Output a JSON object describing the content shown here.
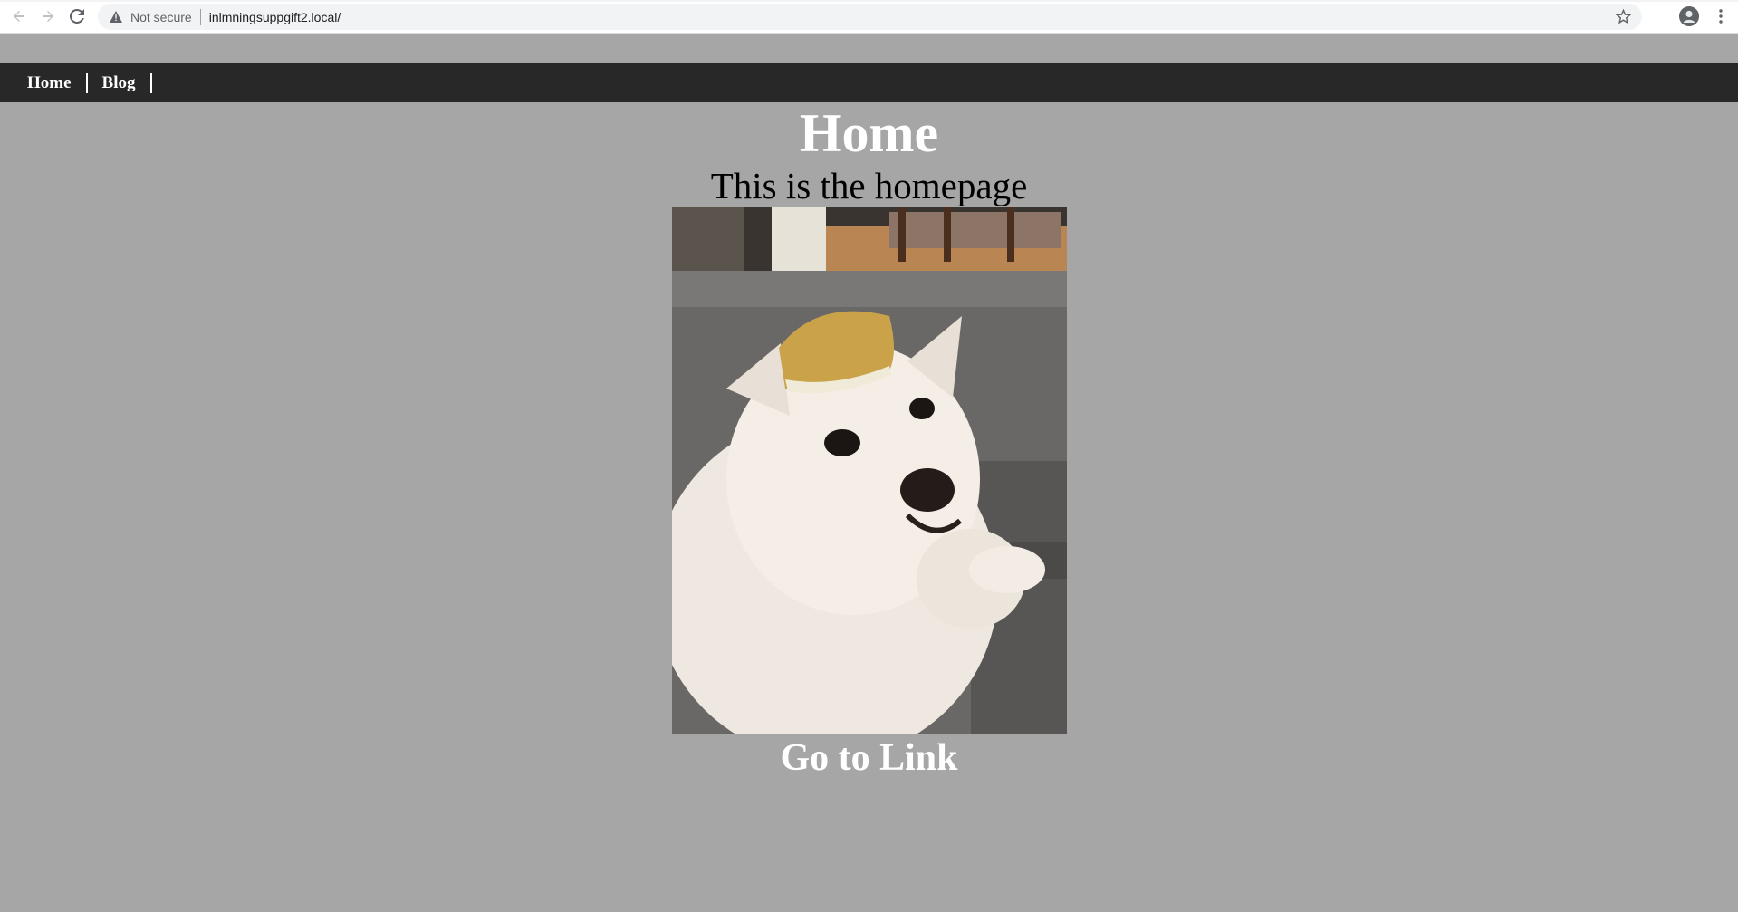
{
  "browser": {
    "security_label": "Not secure",
    "url": "inlmningsuppgift2.local/"
  },
  "nav": {
    "items": [
      {
        "label": "Home"
      },
      {
        "label": "Blog"
      }
    ]
  },
  "main": {
    "heading": "Home",
    "subtitle": "This is the homepage",
    "link_text": "Go to Link"
  },
  "colors": {
    "page_background": "#a6a6a6",
    "navbar_background": "#282828",
    "heading_color": "#ffffff",
    "subtitle_color": "#000000"
  },
  "icons": {
    "back": "arrow-left-icon",
    "forward": "arrow-right-icon",
    "reload": "reload-icon",
    "warning": "warning-triangle-icon",
    "bookmark": "star-icon",
    "profile": "account-icon",
    "menu": "kebab-menu-icon"
  }
}
